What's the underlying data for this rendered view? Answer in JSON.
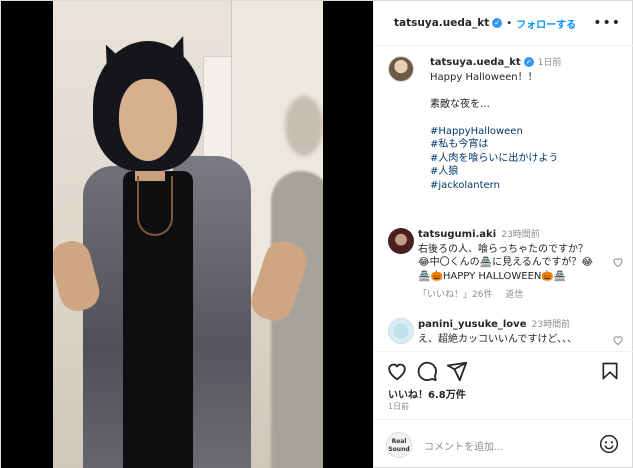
{
  "header": {
    "username": "tatsuya.ueda_kt",
    "verified_mark": "✓",
    "separator": "•",
    "follow_label": "フォローする",
    "more_label": "•••"
  },
  "caption": {
    "username": "tatsuya.ueda_kt",
    "time": "1日前",
    "lines": [
      "Happy Halloween！！",
      "",
      "素敵な夜を…",
      ""
    ],
    "hashtags": [
      "#HappyHalloween",
      "#私も今宵は",
      "#人肉を喰らいに出かけよう",
      "#人狼",
      "#jackolantern"
    ]
  },
  "comments": [
    {
      "username": "tatsugumi.aki",
      "time": "23時間前",
      "lines": [
        "右後ろの人、喰らっちゃたのですか？",
        "😂中〇くんの🏯に見えるんですが？😂",
        "🏯🎃HAPPY HALLOWEEN🎃🏯"
      ],
      "likes_label": "「いいね！」26件",
      "reply_label": "返信"
    },
    {
      "username": "panini_yusuke_love",
      "time": "23時間前",
      "lines": [
        "え、超絶カッコいいんですけど、、、"
      ]
    }
  ],
  "actions": {
    "likes": "いいね！6.8万件",
    "date": "1日前"
  },
  "add_comment": {
    "avatar_text": "Real Sound",
    "placeholder": "コメントを追加..."
  },
  "icons": [
    "more-icon",
    "heart-icon",
    "comment-icon",
    "share-icon",
    "bookmark-icon",
    "emoji-icon",
    "verified-icon"
  ],
  "colors": {
    "link_blue": "#0095f6",
    "hashtag": "#00376b",
    "muted": "#8e8e8e",
    "verified": "#3797f0"
  }
}
